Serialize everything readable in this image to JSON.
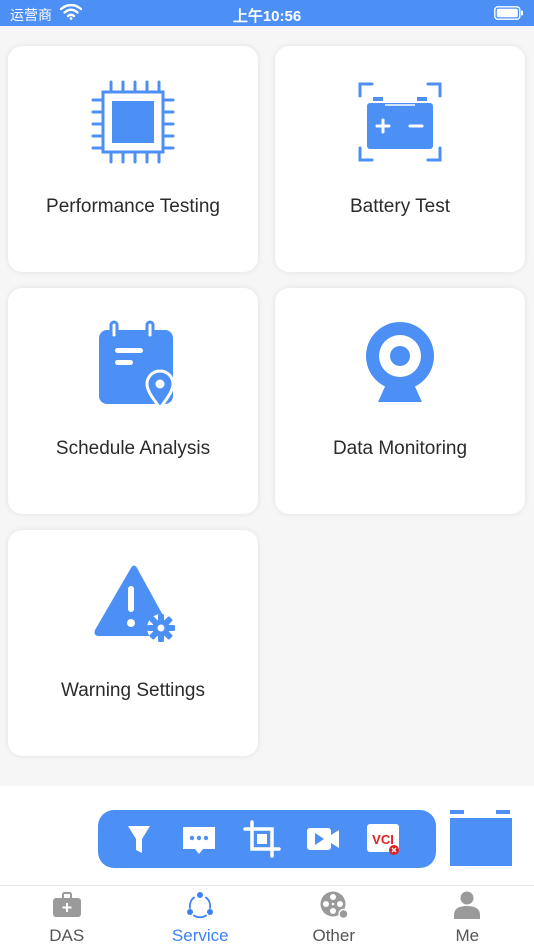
{
  "status": {
    "carrier": "运营商",
    "time": "上午10:56"
  },
  "cards": [
    {
      "label": "Performance Testing"
    },
    {
      "label": "Battery Test"
    },
    {
      "label": "Schedule Analysis"
    },
    {
      "label": "Data Monitoring"
    },
    {
      "label": "Warning Settings"
    }
  ],
  "toolbar": {
    "vci_label": "VCI"
  },
  "tabs": [
    {
      "label": "DAS",
      "icon": "toolbox-icon"
    },
    {
      "label": "Service",
      "icon": "share-circle-icon",
      "active": true
    },
    {
      "label": "Other",
      "icon": "film-reel-icon"
    },
    {
      "label": "Me",
      "icon": "person-icon"
    }
  ],
  "colors": {
    "accent": "#4c8ff5",
    "tab_active": "#3b82f6",
    "tab_inactive": "#555555",
    "vci_text": "#e02020"
  }
}
